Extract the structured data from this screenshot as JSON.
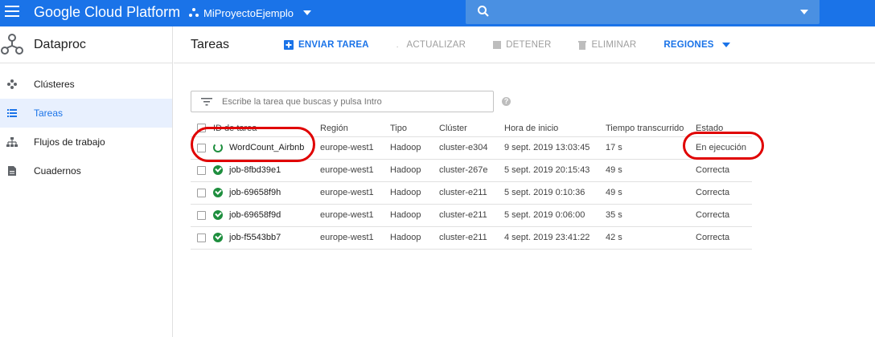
{
  "topbar": {
    "brand": "Google Cloud Platform",
    "project": "MiProyectoEjemplo",
    "search_placeholder": ""
  },
  "sidebar": {
    "product": "Dataproc",
    "items": [
      {
        "label": "Clústeres",
        "icon": "clusters-icon",
        "active": false
      },
      {
        "label": "Tareas",
        "icon": "list-icon",
        "active": true
      },
      {
        "label": "Flujos de trabajo",
        "icon": "workflow-icon",
        "active": false
      },
      {
        "label": "Cuadernos",
        "icon": "notebook-icon",
        "active": false
      }
    ]
  },
  "toolbar": {
    "title": "Tareas",
    "submit": "ENVIAR TAREA",
    "refresh": "ACTUALIZAR",
    "stop": "DETENER",
    "delete": "ELIMINAR",
    "regions": "REGIONES"
  },
  "filter": {
    "placeholder": "Escribe la tarea que buscas y pulsa Intro",
    "help": "?"
  },
  "table": {
    "headers": [
      "ID de tarea",
      "Región",
      "Tipo",
      "Clúster",
      "Hora de inicio",
      "Tiempo transcurrido",
      "Estado"
    ],
    "rows": [
      {
        "id": "WordCount_Airbnb",
        "region": "europe-west1",
        "type": "Hadoop",
        "cluster": "cluster-e304",
        "start": "9 sept. 2019 13:03:45",
        "elapsed": "17 s",
        "status": "En ejecución",
        "running": true
      },
      {
        "id": "job-8fbd39e1",
        "region": "europe-west1",
        "type": "Hadoop",
        "cluster": "cluster-267e",
        "start": "5 sept. 2019 20:15:43",
        "elapsed": "49 s",
        "status": "Correcta",
        "running": false
      },
      {
        "id": "job-69658f9h",
        "region": "europe-west1",
        "type": "Hadoop",
        "cluster": "cluster-e211",
        "start": "5 sept. 2019 0:10:36",
        "elapsed": "49 s",
        "status": "Correcta",
        "running": false
      },
      {
        "id": "job-69658f9d",
        "region": "europe-west1",
        "type": "Hadoop",
        "cluster": "cluster-e211",
        "start": "5 sept. 2019 0:06:00",
        "elapsed": "35 s",
        "status": "Correcta",
        "running": false
      },
      {
        "id": "job-f5543bb7",
        "region": "europe-west1",
        "type": "Hadoop",
        "cluster": "cluster-e211",
        "start": "4 sept. 2019 23:41:22",
        "elapsed": "42 s",
        "status": "Correcta",
        "running": false
      }
    ]
  },
  "colors": {
    "topbar": "#1a73e8",
    "accent": "#1a73e8",
    "success": "#1e8e3e",
    "annotation": "#e00000"
  }
}
